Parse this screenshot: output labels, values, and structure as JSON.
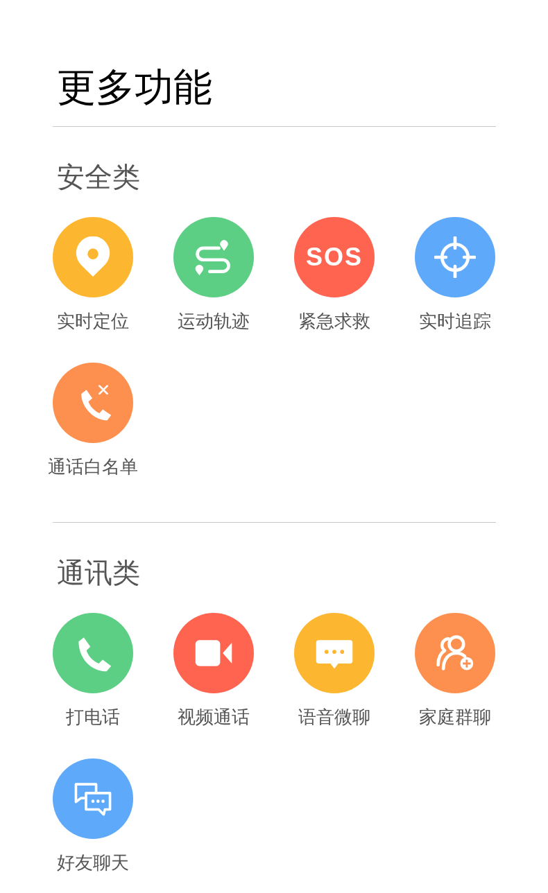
{
  "title": "更多功能",
  "sections": [
    {
      "title": "安全类",
      "items": [
        {
          "label": "实时定位",
          "kind": "pin",
          "color": "#fdb62f"
        },
        {
          "label": "运动轨迹",
          "kind": "route",
          "color": "#5ccf84"
        },
        {
          "label": "紧急求救",
          "kind": "sos",
          "icon_text": "SOS",
          "color": "#fe6450"
        },
        {
          "label": "实时追踪",
          "kind": "target",
          "color": "#5fa9fb"
        },
        {
          "label": "通话白名单",
          "kind": "whitelist",
          "color": "#fd904f"
        }
      ]
    },
    {
      "title": "通讯类",
      "items": [
        {
          "label": "打电话",
          "kind": "phone",
          "color": "#5ccf84"
        },
        {
          "label": "视频通话",
          "kind": "video",
          "color": "#fe6450"
        },
        {
          "label": "语音微聊",
          "kind": "chat",
          "color": "#fdb62f"
        },
        {
          "label": "家庭群聊",
          "kind": "group",
          "color": "#fd904f"
        },
        {
          "label": "好友聊天",
          "kind": "chats",
          "color": "#5fa9fb"
        }
      ]
    }
  ]
}
